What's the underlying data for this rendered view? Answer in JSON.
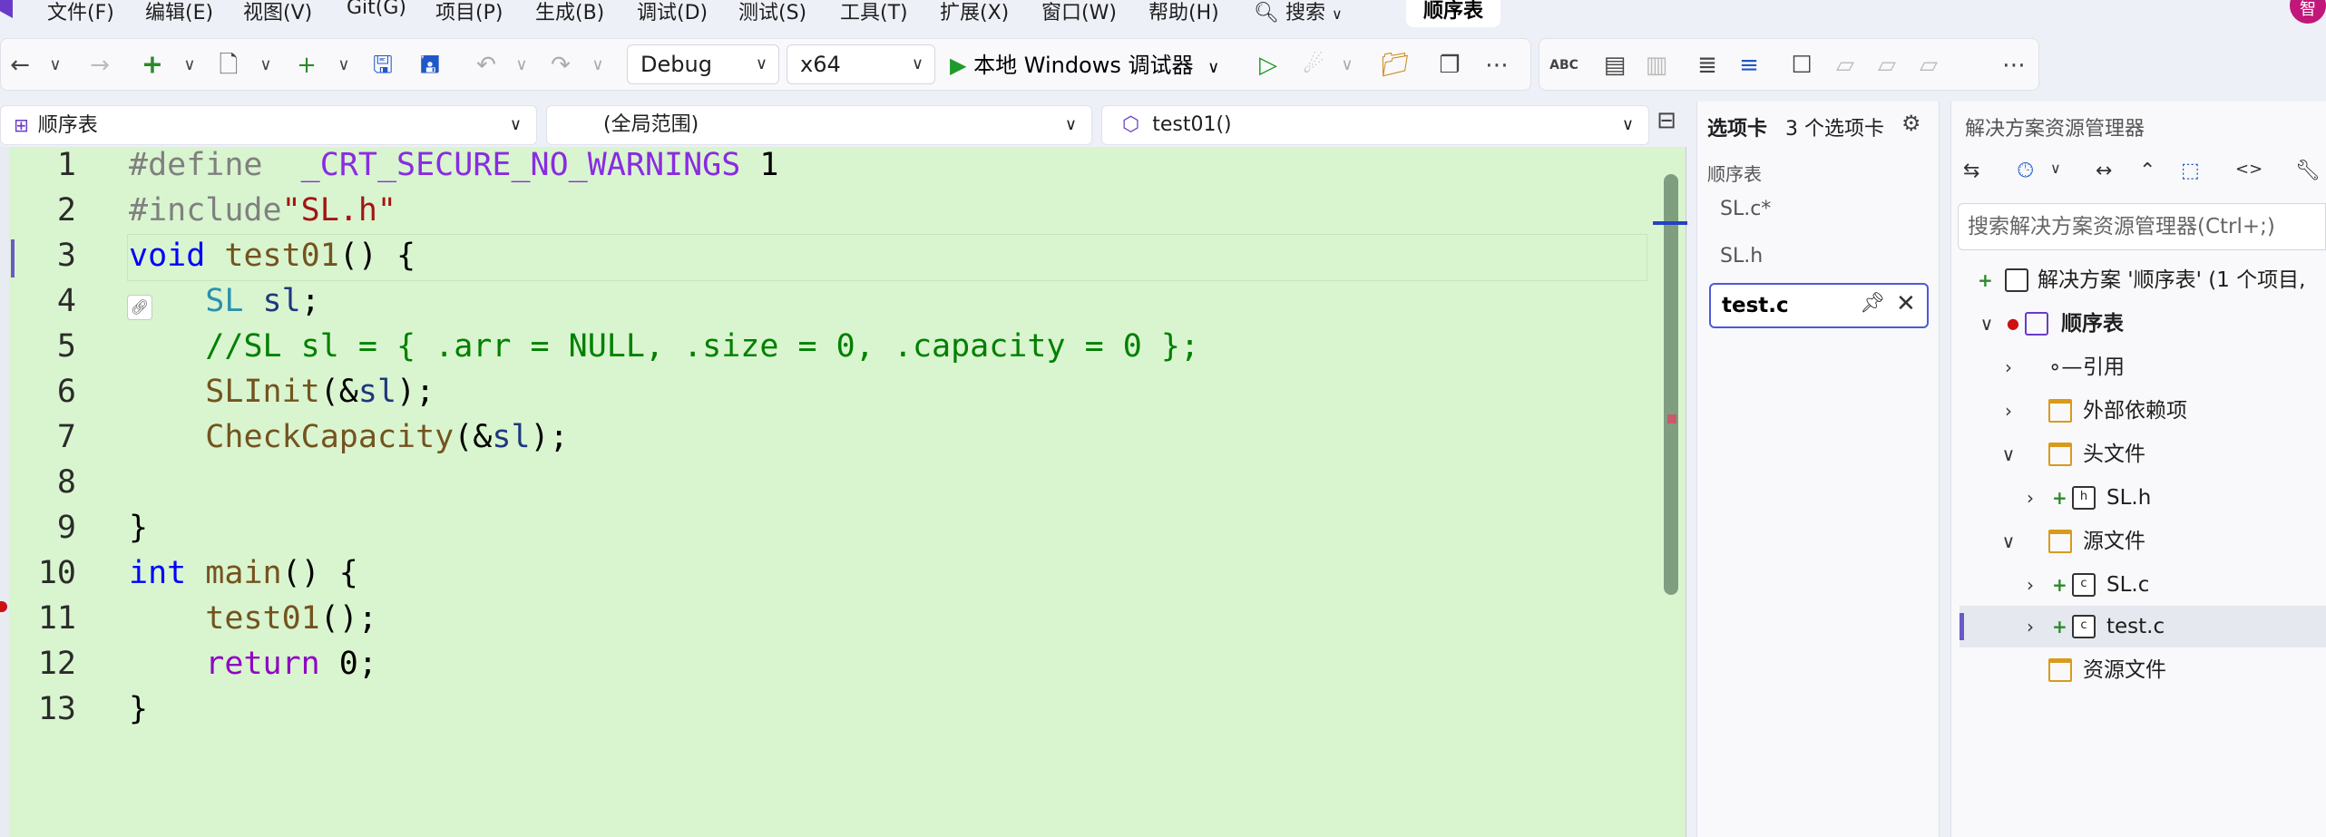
{
  "menu": {
    "items": [
      "文件(F)",
      "编辑(E)",
      "视图(V)",
      "Git(G)",
      "项目(P)",
      "生成(B)",
      "调试(D)",
      "测试(S)",
      "工具(T)",
      "扩展(X)",
      "窗口(W)",
      "帮助(H)"
    ],
    "search_label": "搜索",
    "doc_title": "顺序表",
    "avatar_text": "智"
  },
  "toolbar": {
    "config": "Debug",
    "platform": "x64",
    "run_label": "本地 Windows 调试器"
  },
  "nav": {
    "project": "顺序表",
    "scope": "(全局范围)",
    "member": "test01()"
  },
  "editor": {
    "line_numbers": [
      "1",
      "2",
      "3",
      "4",
      "5",
      "6",
      "7",
      "8",
      "9",
      "10",
      "11",
      "12",
      "13"
    ]
  },
  "tabs_panel": {
    "title": "选项卡",
    "count": "3 个选项卡",
    "group": "顺序表",
    "files": [
      "SL.c*",
      "SL.h",
      "test.c"
    ]
  },
  "solution_explorer": {
    "title": "解决方案资源管理器",
    "search_placeholder": "搜索解决方案资源管理器(Ctrl+;)",
    "solution": "解决方案 '顺序表' (1 个项目,",
    "project": "顺序表",
    "references": "引用",
    "external_deps": "外部依赖项",
    "header_files": "头文件",
    "sl_h": "SL.h",
    "source_files": "源文件",
    "sl_c": "SL.c",
    "test_c": "test.c",
    "resource_files": "资源文件"
  }
}
